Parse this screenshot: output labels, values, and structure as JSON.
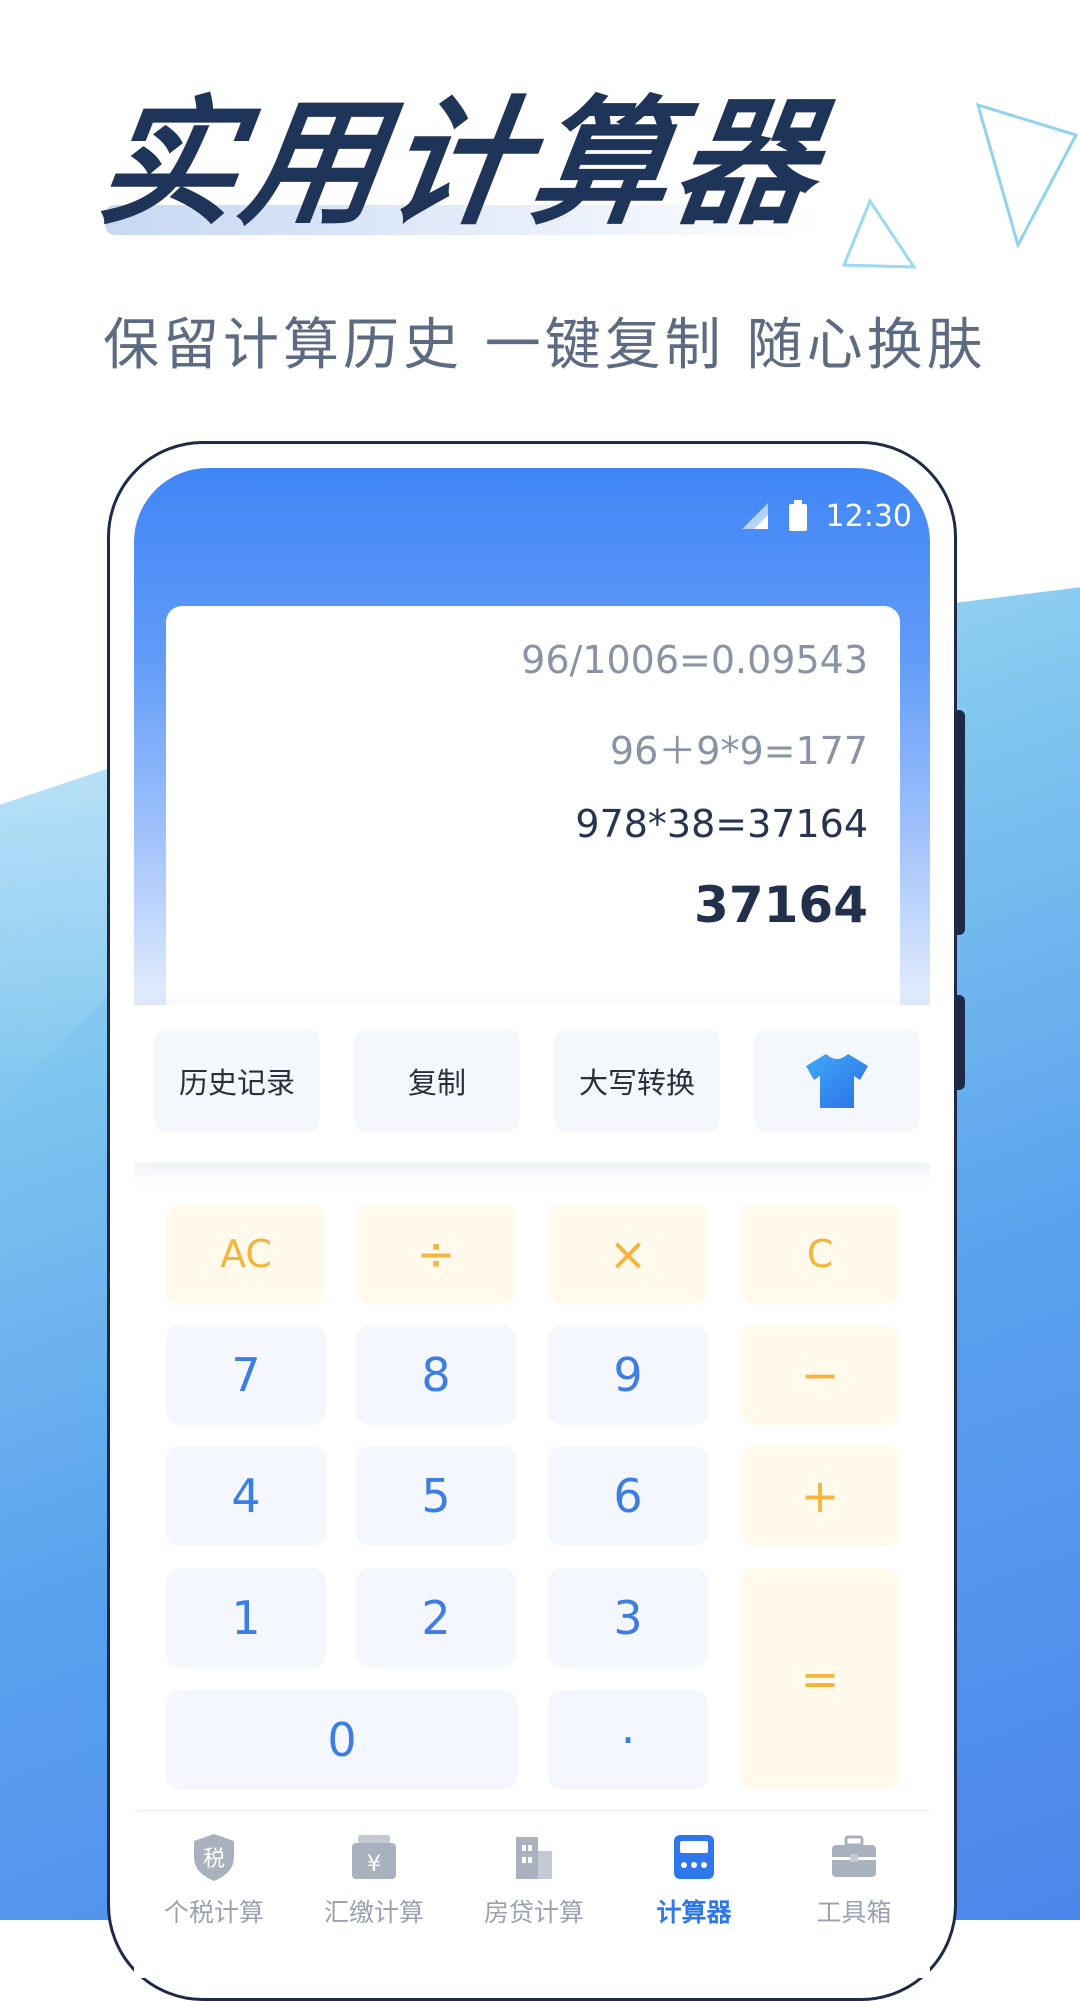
{
  "promo": {
    "title": "实用计算器",
    "subtitle": "保留计算历史 一键复制 随心换肤"
  },
  "status_bar": {
    "time": "12:30"
  },
  "history": {
    "lines": [
      "96/1006=0.09543",
      "96＋9*9=177",
      "978*38=37164"
    ],
    "result": "37164"
  },
  "actions": {
    "history": "历史记录",
    "copy": "复制",
    "uppercase": "大写转换",
    "skin_icon": "tshirt-icon"
  },
  "keypad": {
    "ac": "AC",
    "divide": "÷",
    "multiply": "×",
    "clear": "C",
    "seven": "7",
    "eight": "8",
    "nine": "9",
    "minus": "−",
    "four": "4",
    "five": "5",
    "six": "6",
    "plus": "+",
    "one": "1",
    "two": "2",
    "three": "3",
    "equals": "=",
    "zero": "0",
    "dot": "·"
  },
  "tabs": [
    {
      "label": "个税计算",
      "icon": "tax-shield-icon"
    },
    {
      "label": "汇缴计算",
      "icon": "yuan-wallet-icon"
    },
    {
      "label": "房贷计算",
      "icon": "building-icon"
    },
    {
      "label": "计算器",
      "icon": "calculator-icon",
      "active": true
    },
    {
      "label": "工具箱",
      "icon": "toolbox-icon"
    }
  ],
  "colors": {
    "title": "#1e3459",
    "accent_blue": "#3d7de6",
    "operator_orange": "#f5b43c",
    "tab_active": "#2f77ec"
  }
}
